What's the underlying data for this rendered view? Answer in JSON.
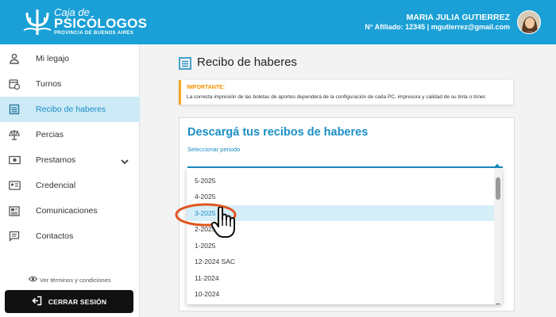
{
  "header": {
    "logo": {
      "line1": "Caja de",
      "line2": "PSICÓLOGOS",
      "line3": "PROVINCIA DE BUENOS AIRES"
    },
    "user_name": "MARIA JULIA GUTIERREZ",
    "user_info": "N° Afiliado: 12345 | mgutierrez@gmail.com"
  },
  "sidebar": {
    "items": [
      {
        "label": "Mi legajo",
        "icon": "person-icon"
      },
      {
        "label": "Turnos",
        "icon": "calendar-clock-icon"
      },
      {
        "label": "Recibo de haberes",
        "icon": "receipt-list-icon",
        "active": true
      },
      {
        "label": "Percias",
        "icon": "scale-icon"
      },
      {
        "label": "Prestamos",
        "icon": "money-icon",
        "expandable": true
      },
      {
        "label": "Credencial",
        "icon": "id-card-icon"
      },
      {
        "label": "Comunicaciones",
        "icon": "newspaper-icon"
      },
      {
        "label": "Contactos",
        "icon": "chat-icon"
      }
    ],
    "terms": "Ver términos y condiciones",
    "logout": "CERRAR SESIÓN"
  },
  "main": {
    "title": "Recibo de haberes",
    "notice": {
      "title": "IMPORTANTE:",
      "text": "La correcta impresión de las boletas de aportes dependerá de la configuración de cada PC, impresora y calidad de su tinta o tóner."
    },
    "card": {
      "title": "Descargá tus recibos de haberes",
      "select_label": "Seleccionar periodo",
      "options": [
        "5-2025",
        "4-2025",
        "3-2025",
        "2-2025",
        "1-2025",
        "12-2024 SAC",
        "11-2024",
        "10-2024"
      ],
      "highlighted_option": "3-2025"
    }
  },
  "colors": {
    "brand": "#1aa0d6",
    "accent": "#1a8ec4",
    "warning": "#f39200",
    "highlight_ring": "#e0551f"
  }
}
